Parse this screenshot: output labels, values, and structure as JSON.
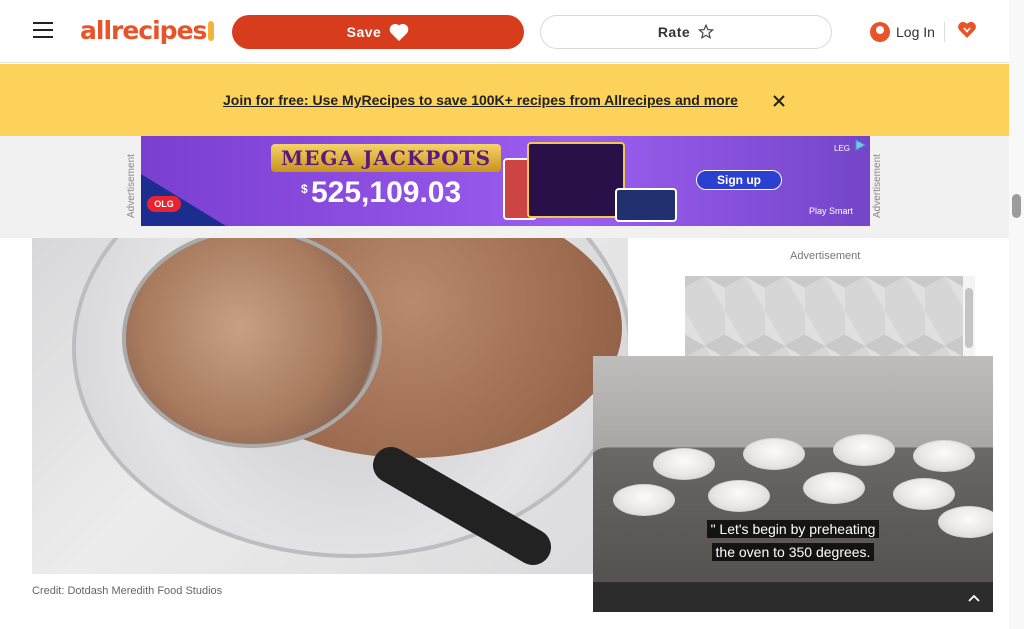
{
  "header": {
    "menu_icon": "hamburger-menu-icon",
    "logo_text": "allrecipes",
    "save_label": "Save",
    "rate_label": "Rate",
    "login_label": "Log In",
    "colors": {
      "brand": "#e8542a",
      "save_bg": "#d73c1d"
    }
  },
  "banner": {
    "text": "Join for free: Use MyRecipes to save 100K+ recipes from Allrecipes and more",
    "bg_color": "#fcd25a"
  },
  "top_ad": {
    "side_label": "Advertisement",
    "brand": "OLG",
    "title": "MEGA JACKPOTS",
    "prize_prefix": "$",
    "prize": "525,109.03",
    "cta": "Sign up",
    "tag_left": "LEG",
    "footer": "Play Smart"
  },
  "main_image": {
    "credit": "Credit: Dotdash Meredith Food Studios"
  },
  "side": {
    "ad_label": "Advertisement"
  },
  "video": {
    "caption_line1": "\" Let's begin by preheating",
    "caption_line2": "the oven to 350 degrees."
  }
}
